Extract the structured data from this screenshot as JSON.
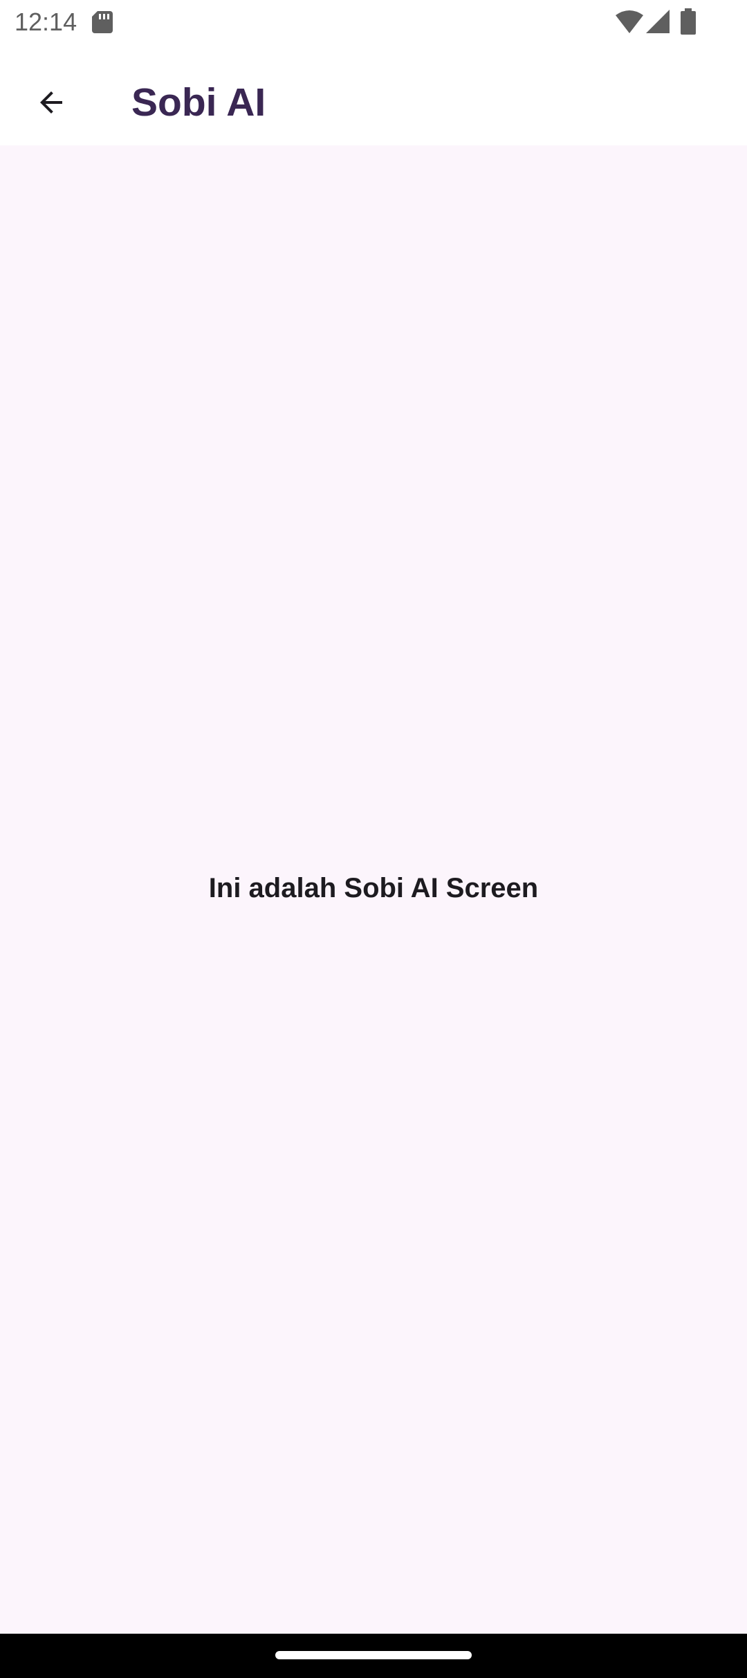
{
  "status_bar": {
    "time": "12:14",
    "icons": [
      "sd-card-icon",
      "wifi-icon",
      "signal-icon",
      "battery-icon"
    ]
  },
  "app_bar": {
    "back_icon": "arrow-back-icon",
    "title": "Sobi AI"
  },
  "main": {
    "message": "Ini adalah Sobi AI Screen"
  },
  "colors": {
    "title": "#3A2753",
    "background": "#FCF5FC",
    "text": "#1D1B20",
    "status_icons": "#5F5F5F",
    "nav_bar": "#000000"
  }
}
